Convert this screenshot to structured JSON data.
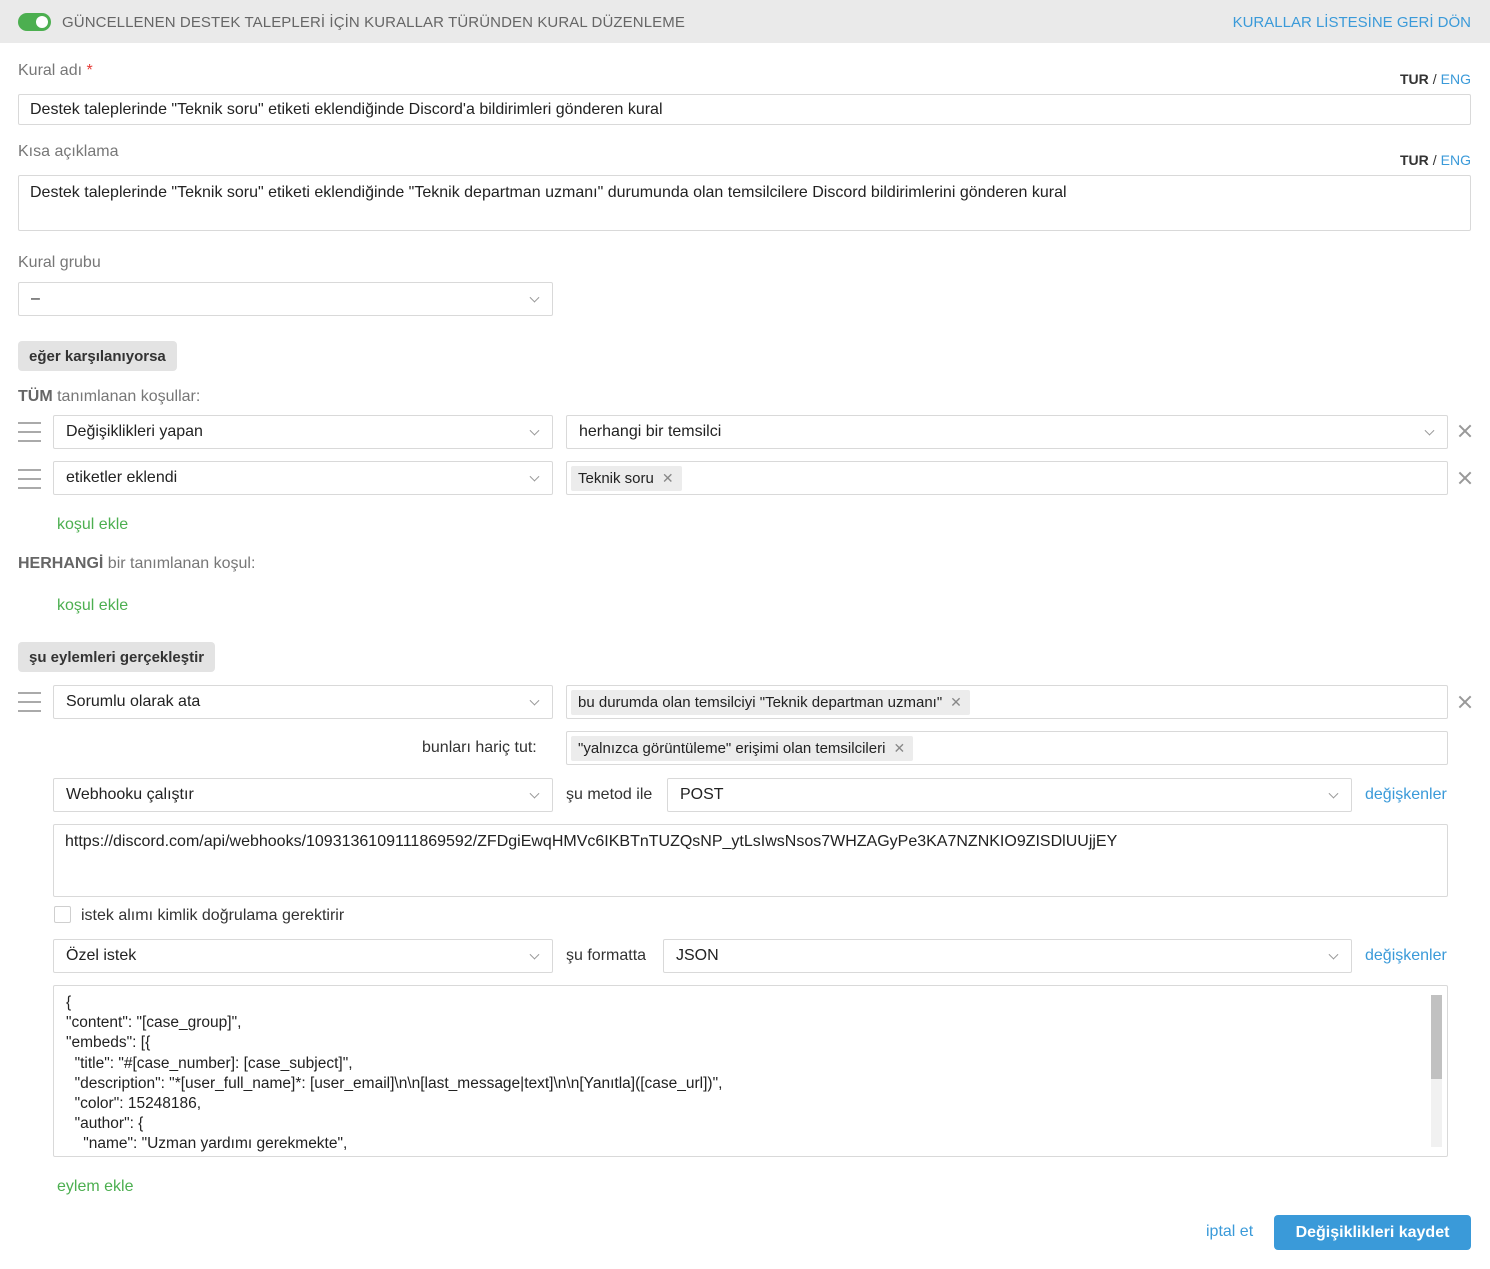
{
  "header": {
    "title": "GÜNCELLENEN DESTEK TALEPLERİ İÇİN KURALLAR TÜRÜNDEN KURAL DÜZENLEME",
    "back_link": "KURALLAR LİSTESİNE GERİ DÖN",
    "toggle_on": true
  },
  "lang": {
    "tur": "TUR",
    "sep": "/",
    "eng": "ENG"
  },
  "rule_name": {
    "label": "Kural adı",
    "required_mark": "*",
    "value": "Destek taleplerinde \"Teknik soru\" etiketi eklendiğinde Discord'a bildirimleri gönderen kural"
  },
  "short_desc": {
    "label": "Kısa açıklama",
    "value": "Destek taleplerinde \"Teknik soru\" etiketi eklendiğinde  \"Teknik departman uzmanı\" durumunda olan temsilcilere Discord bildirimlerini gönderen kural"
  },
  "rule_group": {
    "label": "Kural grubu",
    "value": "–"
  },
  "if_section": {
    "button": "eğer karşılanıyorsa",
    "all_caption_bold": "TÜM",
    "all_caption_rest": "tanımlanan koşullar:",
    "conditions": [
      {
        "field": "Değişiklikleri yapan",
        "value": "herhangi bir temsilci"
      },
      {
        "field": "etiketler eklendi",
        "tag": "Teknik soru"
      }
    ],
    "add_condition": "koşul ekle",
    "any_caption_bold": "HERHANGİ",
    "any_caption_rest": "bir tanımlanan koşul:",
    "add_condition_any": "koşul ekle"
  },
  "actions_section": {
    "button": "şu eylemleri gerçekleştir",
    "assign": {
      "field": "Sorumlu olarak ata",
      "tag": "bu durumda olan temsilciyi \"Teknik departman uzmanı\"",
      "exclude_label": "bunları hariç tut:",
      "exclude_tag": "\"yalnızca görüntüleme\" erişimi olan temsilcileri"
    },
    "webhook": {
      "field": "Webhooku çalıştır",
      "method_label": "şu metod ile",
      "method_value": "POST",
      "variables_link": "değişkenler",
      "url": "https://discord.com/api/webhooks/1093136109111869592/ZFDgiEwqHMVc6IKBTnTUZQsNP_ytLsIwsNsos7WHZAGyPe3KA7NZNKIO9ZISDlUUjjEY",
      "auth_checkbox_label": "istek alımı kimlik doğrulama gerektirir",
      "auth_checked": false,
      "request_type": "Özel istek",
      "format_label": "şu formatta",
      "format_value": "JSON",
      "variables_link2": "değişkenler",
      "body_lines": [
        "{",
        "\"content\": \"[case_group]\",",
        "\"embeds\": [{",
        "  \"title\": \"#[case_number]: [case_subject]\",",
        "  \"description\": \"*[user_full_name]*: [user_email]\\n\\n[last_message|text]\\n\\n[Yanıtla]([case_url])\",",
        "  \"color\": 15248186,",
        "  \"author\": {",
        "    \"name\": \"Uzman yardımı gerekmekte\","
      ]
    },
    "add_action": "eylem ekle"
  },
  "footer": {
    "cancel": "iptal et",
    "save": "Değişiklikleri kaydet"
  },
  "colors": {
    "accent_blue": "#3a9ad9",
    "accent_green": "#4caf50",
    "required_red": "#e53935"
  }
}
